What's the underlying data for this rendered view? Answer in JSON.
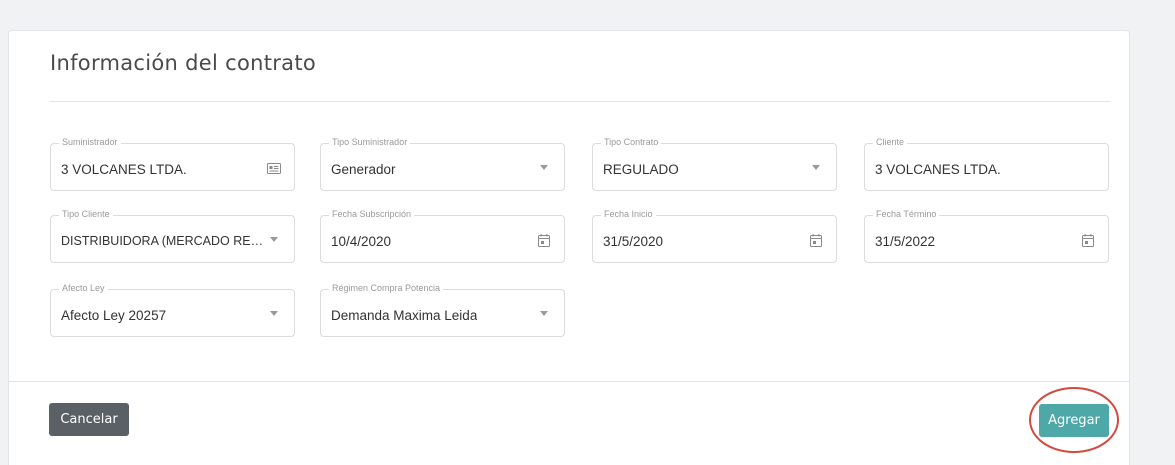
{
  "card": {
    "title": "Información del contrato"
  },
  "fields": [
    {
      "label": "Suministrador",
      "value": "3 VOLCANES LTDA.",
      "icon": "id-card-icon"
    },
    {
      "label": "Tipo Suministrador",
      "value": "Generador",
      "icon": "chevron-down-icon"
    },
    {
      "label": "Tipo Contrato",
      "value": "REGULADO",
      "icon": "chevron-down-icon"
    },
    {
      "label": "Cliente",
      "value": "3 VOLCANES LTDA.",
      "icon": ""
    },
    {
      "label": "Tipo Cliente",
      "value": "DISTRIBUIDORA (MERCADO REG...",
      "icon": "chevron-down-icon"
    },
    {
      "label": "Fecha Subscripción",
      "value": "10/4/2020",
      "icon": "calendar-icon"
    },
    {
      "label": "Fecha Inicio",
      "value": "31/5/2020",
      "icon": "calendar-icon"
    },
    {
      "label": "Fecha Término",
      "value": "31/5/2022",
      "icon": "calendar-icon"
    },
    {
      "label": "Afecto Ley",
      "value": "Afecto Ley 20257",
      "icon": "chevron-down-icon"
    },
    {
      "label": "Régimen Compra Potencia",
      "value": "Demanda Maxima Leida",
      "icon": "chevron-down-icon"
    }
  ],
  "footer": {
    "cancel_label": "Cancelar",
    "add_label": "Agregar"
  },
  "colors": {
    "add_button": "#4ea8a8",
    "cancel_button": "#5a6065",
    "highlight_ring": "#d24a3f"
  }
}
